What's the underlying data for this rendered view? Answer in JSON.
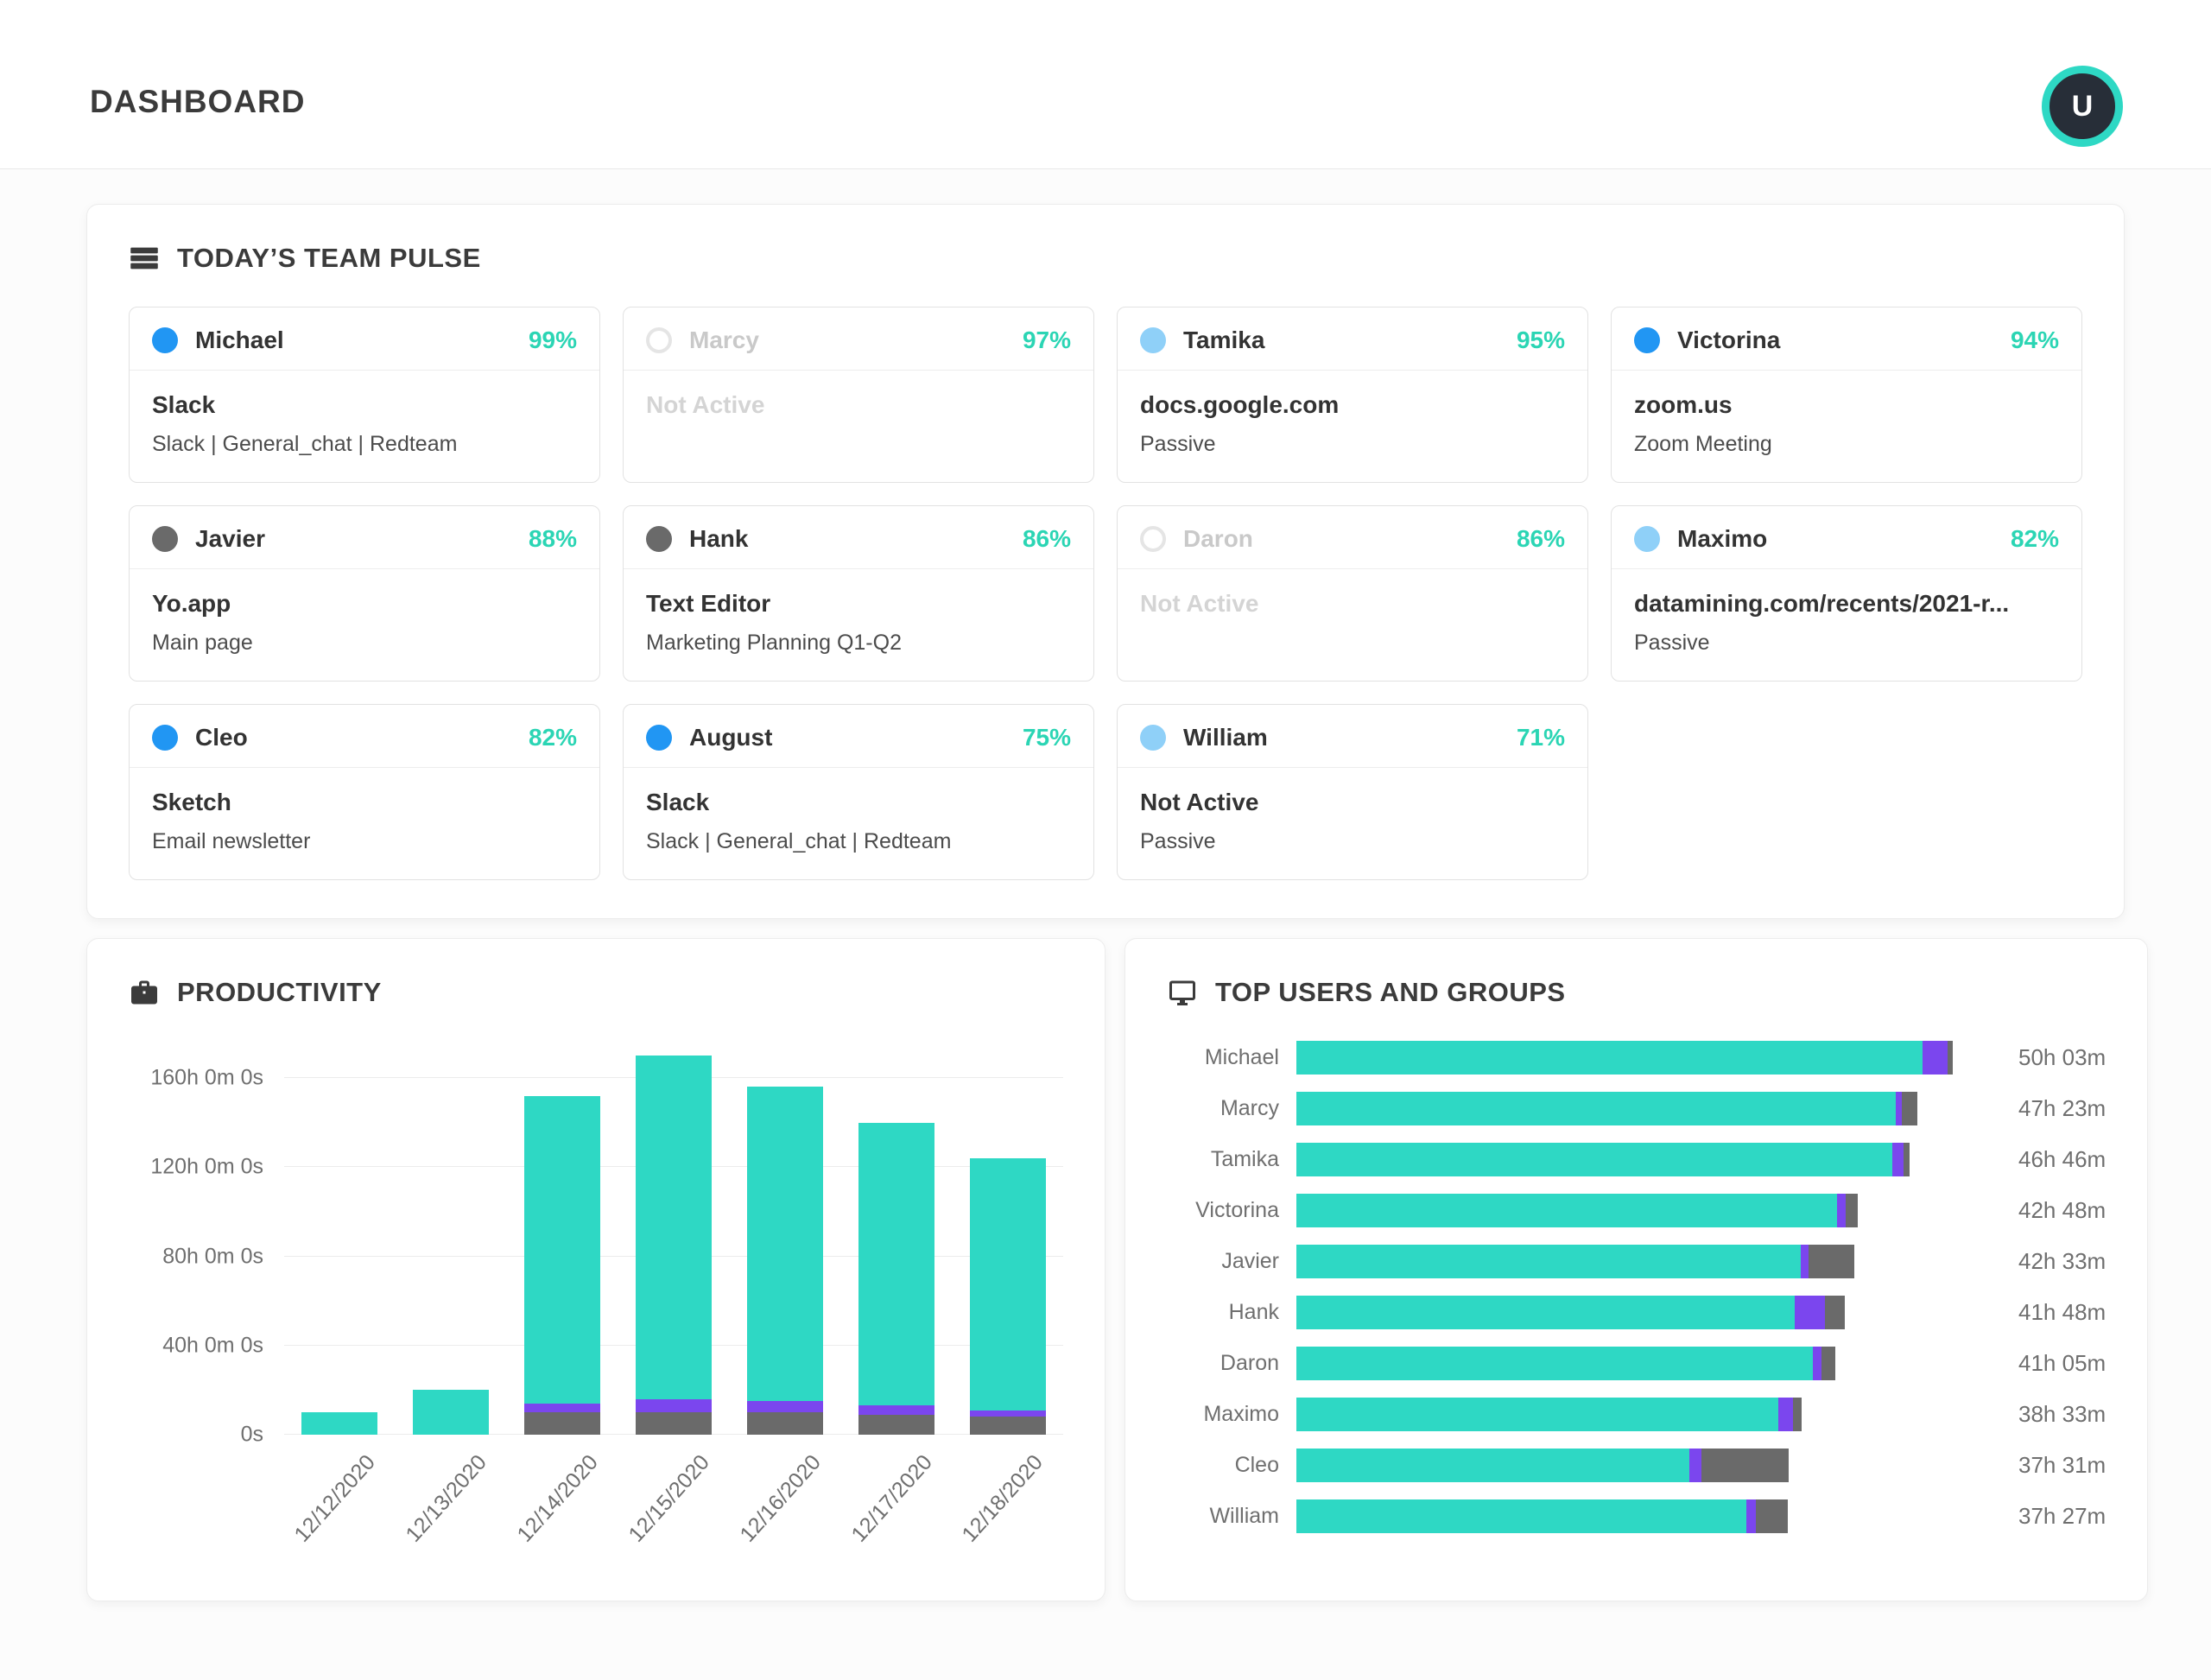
{
  "header": {
    "title": "DASHBOARD",
    "avatar_initial": "U"
  },
  "team_pulse": {
    "title": "TODAY’S TEAM PULSE",
    "members": [
      {
        "name": "Michael",
        "score": "99%",
        "dot": "blue",
        "activity": "Slack",
        "detail": "Slack | General_chat | Redteam",
        "inactive": false
      },
      {
        "name": "Marcy",
        "score": "97%",
        "dot": "none",
        "activity": "Not Active",
        "detail": "",
        "inactive": true
      },
      {
        "name": "Tamika",
        "score": "95%",
        "dot": "light-blue",
        "activity": "docs.google.com",
        "detail": "Passive",
        "inactive": false
      },
      {
        "name": "Victorina",
        "score": "94%",
        "dot": "blue",
        "activity": "zoom.us",
        "detail": "Zoom Meeting",
        "inactive": false
      },
      {
        "name": "Javier",
        "score": "88%",
        "dot": "gray",
        "activity": "Yo.app",
        "detail": "Main page",
        "inactive": false
      },
      {
        "name": "Hank",
        "score": "86%",
        "dot": "gray",
        "activity": "Text Editor",
        "detail": "Marketing Planning Q1-Q2",
        "inactive": false
      },
      {
        "name": "Daron",
        "score": "86%",
        "dot": "none",
        "activity": "Not Active",
        "detail": "",
        "inactive": true
      },
      {
        "name": "Maximo",
        "score": "82%",
        "dot": "light-blue",
        "activity": "datamining.com/recents/2021-r...",
        "detail": "Passive",
        "inactive": false
      },
      {
        "name": "Cleo",
        "score": "82%",
        "dot": "blue",
        "activity": "Sketch",
        "detail": "Email newsletter",
        "inactive": false
      },
      {
        "name": "August",
        "score": "75%",
        "dot": "blue",
        "activity": "Slack",
        "detail": "Slack | General_chat | Redteam",
        "inactive": false
      },
      {
        "name": "William",
        "score": "71%",
        "dot": "light-blue",
        "activity": "Not Active",
        "detail": "Passive",
        "inactive": false
      }
    ]
  },
  "productivity": {
    "title": "PRODUCTIVITY"
  },
  "top_users": {
    "title": "TOP USERS AND GROUPS"
  },
  "chart_data": [
    {
      "type": "bar",
      "title": "PRODUCTIVITY",
      "stacked": true,
      "categories": [
        "12/12/2020",
        "12/13/2020",
        "12/14/2020",
        "12/15/2020",
        "12/16/2020",
        "12/17/2020",
        "12/18/2020"
      ],
      "series": [
        {
          "name": "gray",
          "values": [
            0,
            0,
            10,
            10,
            10,
            9,
            8
          ]
        },
        {
          "name": "purple",
          "values": [
            0,
            0,
            4,
            6,
            5,
            4,
            3
          ]
        },
        {
          "name": "teal",
          "values": [
            10,
            20,
            138,
            154,
            141,
            127,
            113
          ]
        }
      ],
      "totals_hours": [
        10,
        20,
        152,
        170,
        156,
        140,
        124
      ],
      "yticks": [
        {
          "hours": 0,
          "label": "0s"
        },
        {
          "hours": 40,
          "label": "40h 0m 0s"
        },
        {
          "hours": 80,
          "label": "80h 0m 0s"
        },
        {
          "hours": 120,
          "label": "120h 0m 0s"
        },
        {
          "hours": 160,
          "label": "160h 0m 0s"
        }
      ],
      "ylim": [
        0,
        178
      ],
      "grid": true,
      "legend": false
    },
    {
      "type": "bar",
      "orientation": "horizontal",
      "title": "TOP USERS AND GROUPS",
      "stacked": true,
      "categories": [
        "Michael",
        "Marcy",
        "Tamika",
        "Victorina",
        "Javier",
        "Hank",
        "Daron",
        "Maximo",
        "Cleo",
        "William"
      ],
      "value_labels": [
        "50h 03m",
        "47h 23m",
        "46h 46m",
        "42h 48m",
        "42h 33m",
        "41h 48m",
        "41h 05m",
        "38h 33m",
        "37h 31m",
        "37h 27m"
      ],
      "totals_hours": [
        50.05,
        47.38,
        46.77,
        42.8,
        42.55,
        41.8,
        41.08,
        38.55,
        37.52,
        37.45
      ],
      "series": [
        {
          "name": "teal",
          "pct_of_bar": [
            95.4,
            96.4,
            97.1,
            96.3,
            90.4,
            90.9,
            95.9,
            95.3,
            79.8,
            91.6
          ]
        },
        {
          "name": "purple",
          "pct_of_bar": [
            3.8,
            1.1,
            1.9,
            1.5,
            1.4,
            5.5,
            1.5,
            2.9,
            2.5,
            2.0
          ]
        },
        {
          "name": "gray",
          "pct_of_bar": [
            0.8,
            2.5,
            1.0,
            2.2,
            8.2,
            3.6,
            2.6,
            1.8,
            17.7,
            6.4
          ]
        }
      ],
      "legend": false
    }
  ],
  "colors": {
    "teal": "#2ED8C4",
    "purple": "#7B46EE",
    "gray": "#6A6A6A",
    "accent_text": "#2BD5B4",
    "dot_blue": "#2196F3",
    "dot_light_blue": "#8FD0F8",
    "dot_gray": "#6A6A6A",
    "avatar_ring": "#2BD9C0",
    "avatar_bg": "#272E38"
  }
}
